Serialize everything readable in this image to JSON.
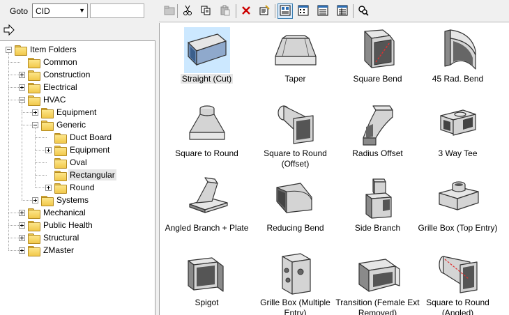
{
  "goto": {
    "label": "Goto",
    "selected": "CID",
    "search_value": ""
  },
  "tree": {
    "items": [
      {
        "label": "Item Folders",
        "level": 0,
        "expander": "open"
      },
      {
        "label": "Common",
        "level": 1,
        "expander": "none"
      },
      {
        "label": "Construction",
        "level": 1,
        "expander": "closed"
      },
      {
        "label": "Electrical",
        "level": 1,
        "expander": "closed"
      },
      {
        "label": "HVAC",
        "level": 1,
        "expander": "open"
      },
      {
        "label": "Equipment",
        "level": 2,
        "expander": "closed"
      },
      {
        "label": "Generic",
        "level": 2,
        "expander": "open"
      },
      {
        "label": "Duct Board",
        "level": 3,
        "expander": "none"
      },
      {
        "label": "Equipment",
        "level": 3,
        "expander": "closed"
      },
      {
        "label": "Oval",
        "level": 3,
        "expander": "none"
      },
      {
        "label": "Rectangular",
        "level": 3,
        "expander": "none",
        "selected": true
      },
      {
        "label": "Round",
        "level": 3,
        "expander": "closed"
      },
      {
        "label": "Systems",
        "level": 2,
        "expander": "closed"
      },
      {
        "label": "Mechanical",
        "level": 1,
        "expander": "closed"
      },
      {
        "label": "Public Health",
        "level": 1,
        "expander": "closed"
      },
      {
        "label": "Structural",
        "level": 1,
        "expander": "closed"
      },
      {
        "label": "ZMaster",
        "level": 1,
        "expander": "closed"
      }
    ]
  },
  "toolbar": {
    "buttons": [
      {
        "icon": "open-folder-icon",
        "active": false
      },
      {
        "icon": "cut-icon",
        "active": false
      },
      {
        "icon": "copy-icon",
        "active": false
      },
      {
        "icon": "paste-icon",
        "active": false
      },
      {
        "icon": "delete-icon",
        "active": false
      },
      {
        "icon": "properties-icon",
        "active": false
      },
      {
        "icon": "large-icons-view-icon",
        "active": true
      },
      {
        "icon": "small-icons-view-icon",
        "active": false
      },
      {
        "icon": "list-view-icon",
        "active": false
      },
      {
        "icon": "details-view-icon",
        "active": false
      },
      {
        "icon": "find-icon",
        "active": false
      }
    ]
  },
  "items": [
    {
      "label": "Straight (Cut)",
      "shape": "straight",
      "selected": true
    },
    {
      "label": "Taper",
      "shape": "taper"
    },
    {
      "label": "Square Bend",
      "shape": "squarebend"
    },
    {
      "label": "45 Rad. Bend",
      "shape": "radbend"
    },
    {
      "label": "Square to Round",
      "shape": "sqround"
    },
    {
      "label": "Square to Round (Offset)",
      "shape": "sqroundoff"
    },
    {
      "label": "Radius Offset",
      "shape": "radoffset"
    },
    {
      "label": "3 Way Tee",
      "shape": "tee"
    },
    {
      "label": "Angled Branch + Plate",
      "shape": "angbranch"
    },
    {
      "label": "Reducing Bend",
      "shape": "redbend"
    },
    {
      "label": "Side Branch",
      "shape": "sidebranch"
    },
    {
      "label": "Grille Box (Top Entry)",
      "shape": "grilletop"
    },
    {
      "label": "Spigot",
      "shape": "spigot"
    },
    {
      "label": "Grille Box (Multiple Entry)",
      "shape": "grillemulti"
    },
    {
      "label": "Transition (Female Ext Removed)",
      "shape": "transition"
    },
    {
      "label": "Square to Round (Angled)",
      "shape": "sqroundang"
    }
  ]
}
